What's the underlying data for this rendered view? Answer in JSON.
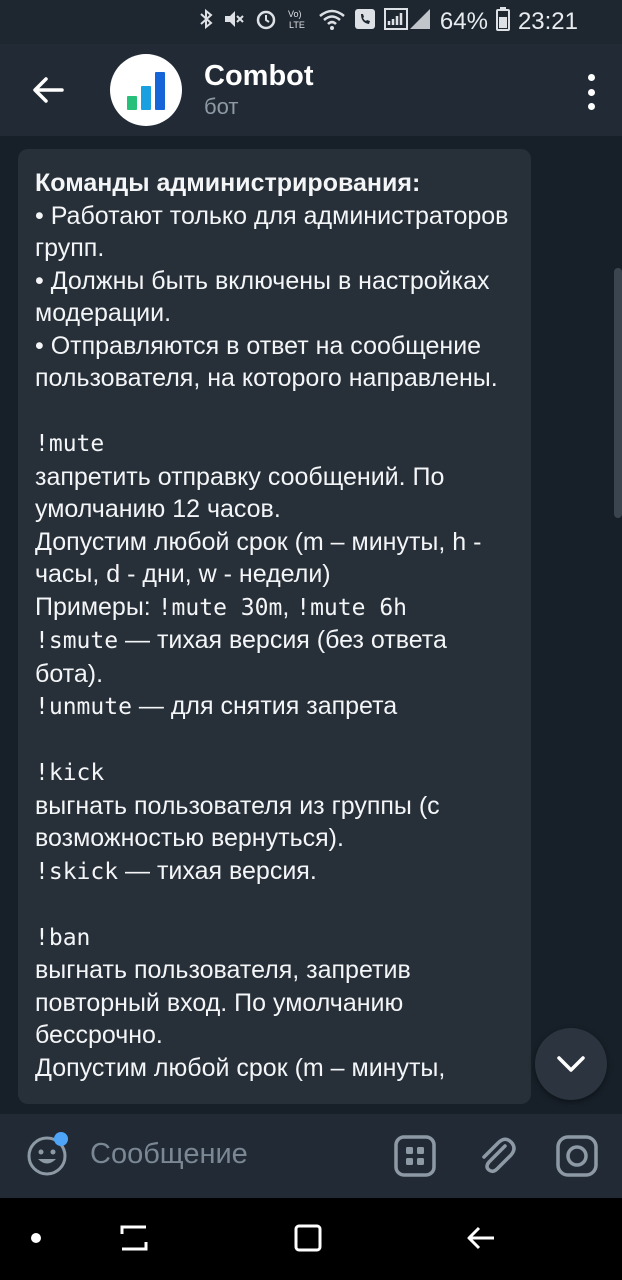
{
  "status_bar": {
    "battery": "64%",
    "time": "23:21",
    "icons": [
      "bluetooth-icon",
      "mute-icon",
      "alarm-icon",
      "volte-icon",
      "wifi-icon",
      "call-icon",
      "signal-icon",
      "battery-icon"
    ],
    "volte_text": "Vo)\nLTE"
  },
  "header": {
    "title": "Combot",
    "subtitle": "бот",
    "avatar_colors": [
      "#27c07a",
      "#1a9fe0",
      "#1565d8"
    ]
  },
  "message": {
    "heading": "Команды администрирования:",
    "bullets": [
      "• Работают только для администраторов групп.",
      "• Должны быть включены в настройках модерации.",
      "• Отправляются в ответ на сообщение пользователя, на которого направлены."
    ],
    "mute": {
      "cmd": "!mute",
      "desc": "запретить отправку сообщений. По умолчанию 12 часов.",
      "terms": "Допустим любой срок (m – минуты, h - часы, d - дни, w - недели)",
      "examples_label": "Примеры: ",
      "example1": "!mute 30m",
      "example_sep": ", ",
      "example2": "!mute 6h",
      "smute_cmd": "!smute",
      "smute_desc": " — тихая версия (без ответа бота).",
      "unmute_cmd": "!unmute",
      "unmute_desc": " — для снятия запрета"
    },
    "kick": {
      "cmd": "!kick",
      "desc": "выгнать пользователя из группы (с возможностью вернуться).",
      "skick_cmd": "!skick",
      "skick_desc": " — тихая версия."
    },
    "ban": {
      "cmd": "!ban",
      "desc": "выгнать пользователя, запретив повторный вход. По умолчанию бессрочно.",
      "terms": "Допустим любой срок (m – минуты,"
    }
  },
  "input": {
    "placeholder": "Сообщение"
  },
  "colors": {
    "accent": "#4ea4f6",
    "chat_bg": "#171f28",
    "bubble_bg": "#272f38"
  }
}
